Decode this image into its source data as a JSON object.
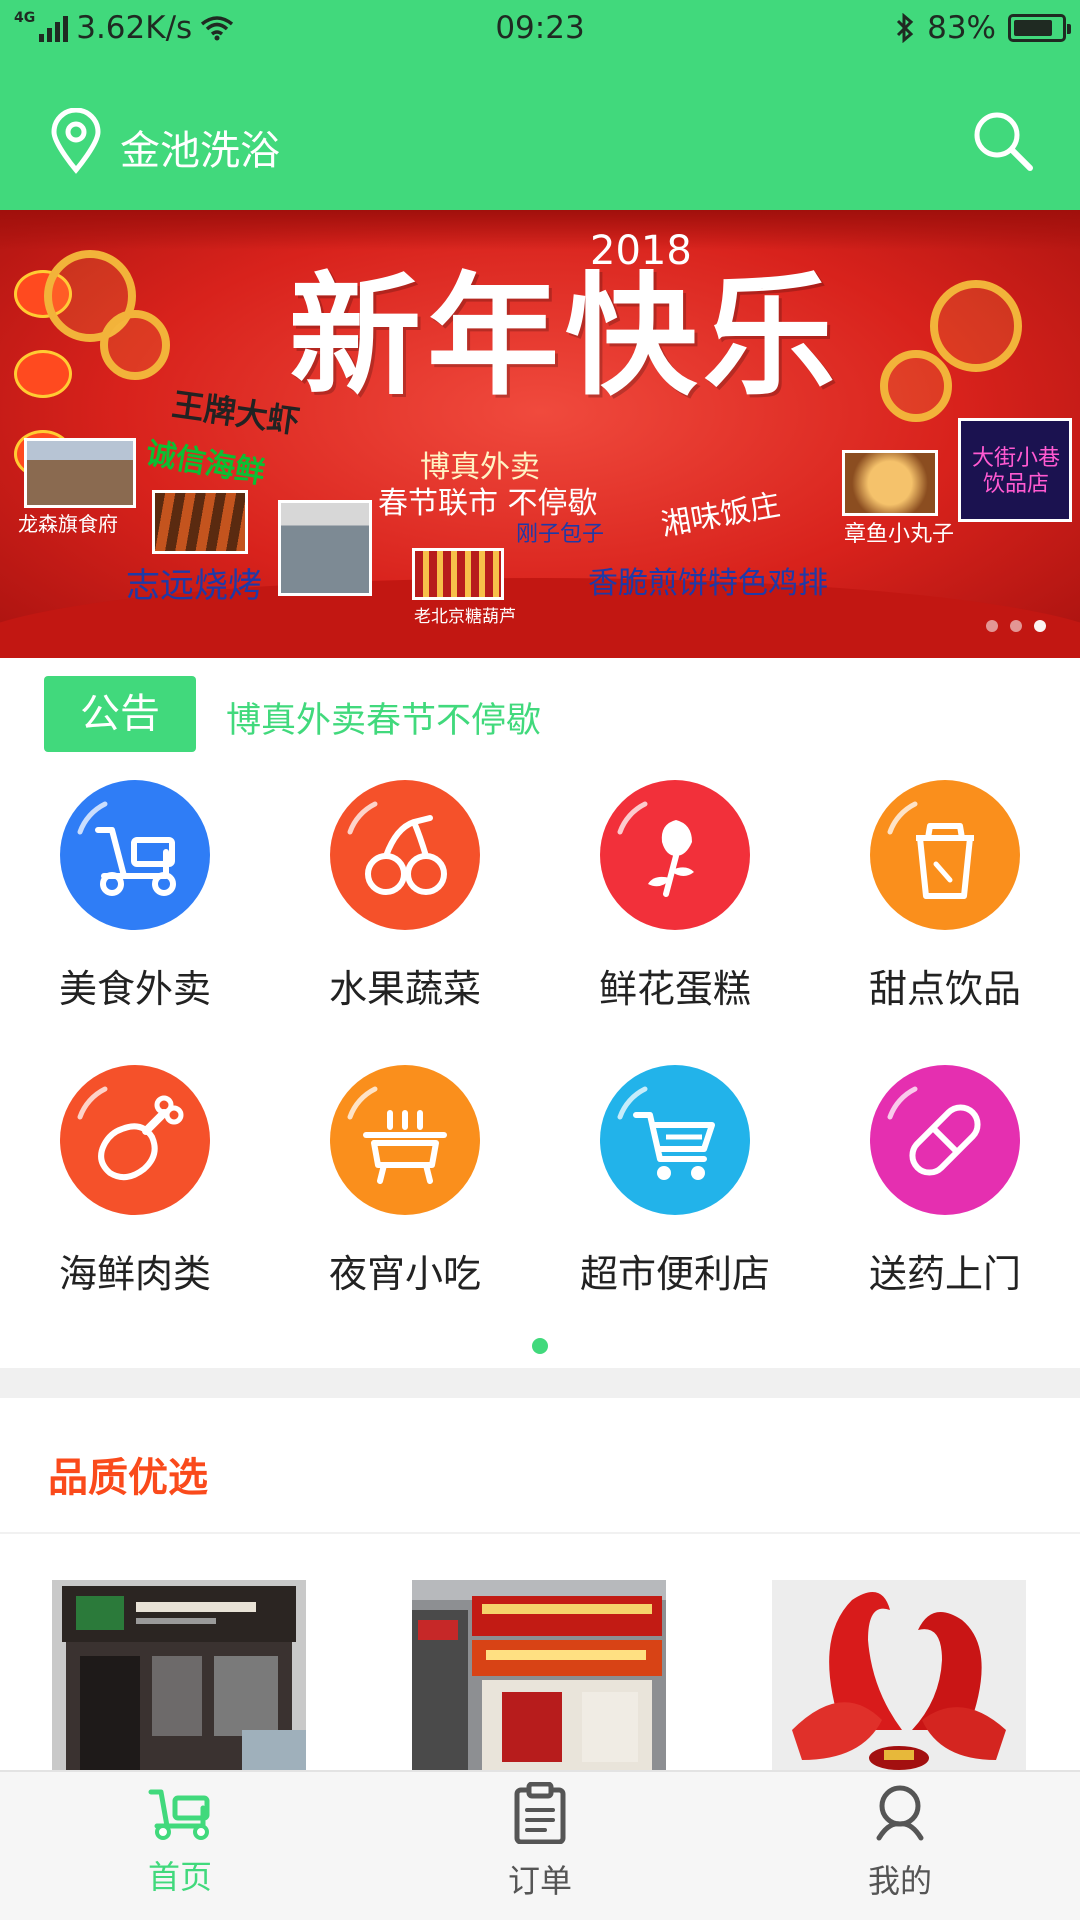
{
  "status_bar": {
    "network": "4G",
    "speed": "3.62K/s",
    "time": "09:23",
    "battery": "83%",
    "battery_level": 0.83
  },
  "header": {
    "location": "金池洗浴",
    "location_icon": "location-pin-icon",
    "search_icon": "search-icon"
  },
  "banner": {
    "year": "2018",
    "title": "新年快乐",
    "brand": "博真外卖",
    "slogan": "春节联市 不停歇",
    "signature": "刚子包子",
    "tags": {
      "shrimp": "王牌大虾",
      "seafood": "诚信海鲜",
      "longsen": "龙森旗食府",
      "zhiyuan": "志远烧烤",
      "hulu": "老北京糖葫芦",
      "xiangwei": "湘味饭庄",
      "octopus": "章鱼小丸子",
      "pancake": "香脆煎饼特色鸡排",
      "dajie": "大街小巷饮品店"
    },
    "slide_count": 3,
    "active_slide": 2
  },
  "notice": {
    "badge": "公告",
    "text": "博真外卖春节不停歇"
  },
  "categories": [
    {
      "label": "美食外卖",
      "icon": "scooter-icon",
      "color": "#2f7df6"
    },
    {
      "label": "水果蔬菜",
      "icon": "cherry-icon",
      "color": "#f5512a"
    },
    {
      "label": "鲜花蛋糕",
      "icon": "rose-icon",
      "color": "#f2303a"
    },
    {
      "label": "甜点饮品",
      "icon": "drink-cup-icon",
      "color": "#fa8f1c"
    },
    {
      "label": "海鲜肉类",
      "icon": "drumstick-icon",
      "color": "#f5512a"
    },
    {
      "label": "夜宵小吃",
      "icon": "barbecue-icon",
      "color": "#fa8f1c"
    },
    {
      "label": "超市便利店",
      "icon": "shopping-cart-icon",
      "color": "#22b3ea"
    },
    {
      "label": "送药上门",
      "icon": "pill-icon",
      "color": "#e52fb0"
    }
  ],
  "quality": {
    "title": "品质优选"
  },
  "tabs": [
    {
      "label": "首页",
      "icon": "scooter-icon",
      "active": true
    },
    {
      "label": "订单",
      "icon": "clipboard-icon",
      "active": false
    },
    {
      "label": "我的",
      "icon": "user-icon",
      "active": false
    }
  ],
  "colors": {
    "brand": "#41d97c",
    "accent": "#fa4a1b",
    "tab_inactive": "#555555"
  }
}
